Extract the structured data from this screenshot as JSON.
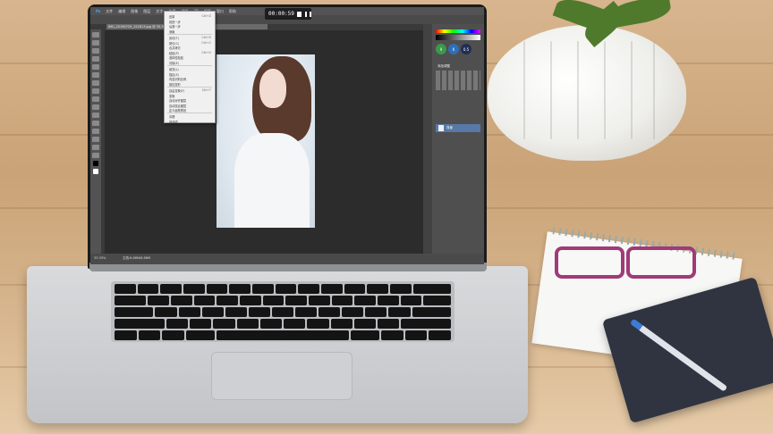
{
  "recorder": {
    "time": "00:00:59"
  },
  "menubar": {
    "items": [
      "文件",
      "编辑",
      "图像",
      "图层",
      "文字",
      "选择",
      "滤镜",
      "3D",
      "视图",
      "窗口",
      "帮助"
    ]
  },
  "menu": {
    "items": [
      {
        "label": "还原",
        "shortcut": "Ctrl+Z"
      },
      {
        "label": "前进一步",
        "shortcut": ""
      },
      {
        "label": "后退一步",
        "shortcut": ""
      },
      {
        "label": "渐隐",
        "shortcut": ""
      },
      {
        "label": "剪切(T)",
        "shortcut": "Ctrl+X"
      },
      {
        "label": "拷贝(C)",
        "shortcut": "Ctrl+C"
      },
      {
        "label": "合并拷贝",
        "shortcut": ""
      },
      {
        "label": "粘贴(P)",
        "shortcut": "Ctrl+V"
      },
      {
        "label": "选择性粘贴",
        "shortcut": ""
      },
      {
        "label": "清除(E)",
        "shortcut": ""
      },
      {
        "label": "填充(L)",
        "shortcut": ""
      },
      {
        "label": "描边(S)",
        "shortcut": ""
      },
      {
        "label": "内容识别比例",
        "shortcut": ""
      },
      {
        "label": "操控变形",
        "shortcut": ""
      },
      {
        "label": "自由变换(F)",
        "shortcut": "Ctrl+T"
      },
      {
        "label": "变换",
        "shortcut": ""
      },
      {
        "label": "自动对齐图层",
        "shortcut": ""
      },
      {
        "label": "自动混合图层",
        "shortcut": ""
      },
      {
        "label": "定义画笔预设",
        "shortcut": ""
      },
      {
        "label": "清理",
        "shortcut": ""
      },
      {
        "label": "首选项",
        "shortcut": ""
      }
    ]
  },
  "document": {
    "tab": "IMG_20190729_152813.jpg @ 33.3% (RGB/8#)",
    "zoom": "33.33%",
    "doc_info": "文档:6.86M/6.86M"
  },
  "panels": {
    "tab": "调整",
    "adj_label": "添加调整",
    "badge_left": "9",
    "badge_mid": "K",
    "badge_right": "0.5",
    "layer_name": "背景"
  },
  "colors": {
    "accent": "#5878a8",
    "ps_bg": "#535353"
  }
}
